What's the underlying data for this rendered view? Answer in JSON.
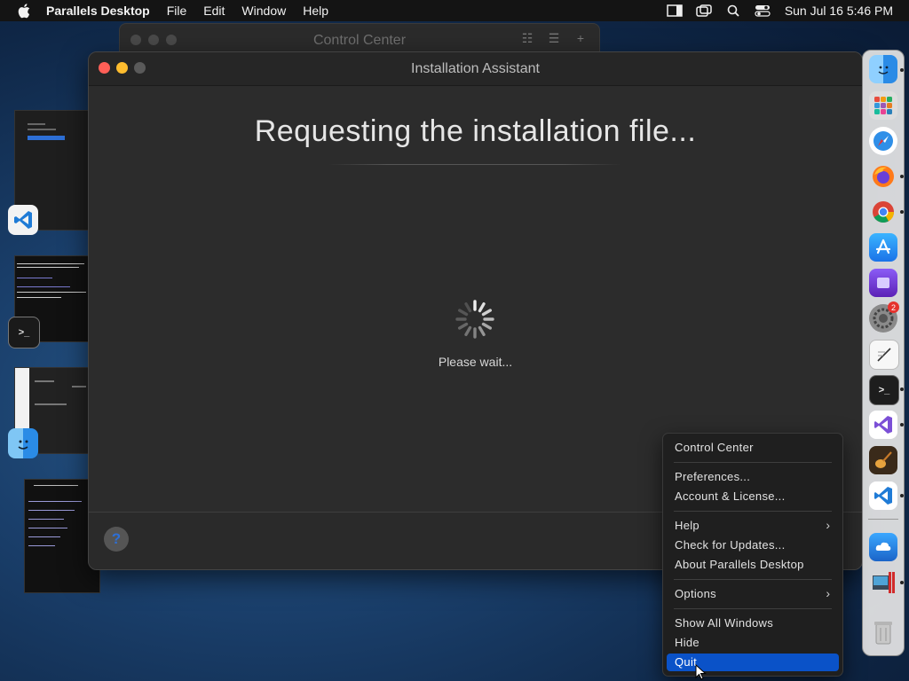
{
  "menubar": {
    "app_name": "Parallels Desktop",
    "items": [
      "File",
      "Edit",
      "Window",
      "Help"
    ],
    "clock": "Sun Jul 16  5:46 PM"
  },
  "background_window": {
    "title": "Control Center"
  },
  "installer": {
    "title": "Installation Assistant",
    "heading": "Requesting the installation file...",
    "status": "Please wait...",
    "help_glyph": "?"
  },
  "context_menu": {
    "items": [
      {
        "label": "Control Center",
        "submenu": false
      },
      {
        "label": "Preferences...",
        "submenu": false
      },
      {
        "label": "Account & License...",
        "submenu": false
      },
      {
        "label": "Help",
        "submenu": true
      },
      {
        "label": "Check for Updates...",
        "submenu": false
      },
      {
        "label": "About Parallels Desktop",
        "submenu": false
      },
      {
        "label": "Options",
        "submenu": true
      },
      {
        "label": "Show All Windows",
        "submenu": false
      },
      {
        "label": "Hide",
        "submenu": false
      },
      {
        "label": "Quit",
        "submenu": false,
        "selected": true
      }
    ],
    "submenu_glyph": "›"
  },
  "dock": {
    "apps": [
      "finder-icon",
      "launchpad-icon",
      "safari-icon",
      "firefox-icon",
      "chrome-icon",
      "app-store-icon",
      "tableplus-icon",
      "system-settings-icon",
      "textedit-icon",
      "terminal-icon",
      "visual-studio-icon",
      "garageband-icon",
      "vscode-icon",
      "cloud-icon",
      "parallels-icon",
      "trash-icon"
    ],
    "settings_badge": "2"
  },
  "colors": {
    "accent": "#0a52c8",
    "close": "#ff5f57",
    "minimize": "#febc2e",
    "zoom": "#5a5a5a"
  }
}
